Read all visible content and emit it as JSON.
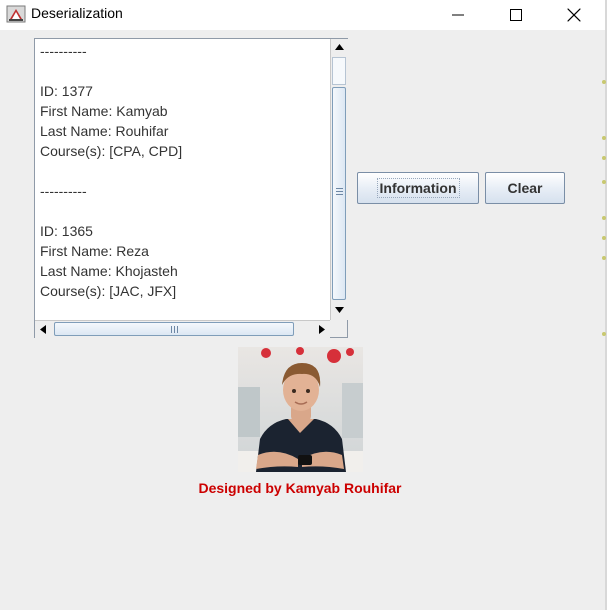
{
  "window": {
    "title": "Deserialization"
  },
  "textarea": {
    "lines": [
      "----------",
      "",
      "ID: 1377",
      "First Name: Kamyab",
      "Last Name: Rouhifar",
      "Course(s): [CPA, CPD]",
      "",
      "----------",
      "",
      "ID: 1365",
      "First Name: Reza",
      "Last Name: Khojasteh",
      "Course(s): [JAC, JFX]"
    ]
  },
  "buttons": {
    "information_label": "Information",
    "clear_label": "Clear"
  },
  "footer": {
    "credit": "Designed by Kamyab Rouhifar"
  },
  "colors": {
    "credit": "#cc0000",
    "window_bg": "#eeeeee",
    "button_border": "#7a8ea6"
  },
  "icons": {
    "app": "java-cup-icon",
    "minimize": "minimize-icon",
    "maximize": "maximize-icon",
    "close": "close-icon"
  }
}
